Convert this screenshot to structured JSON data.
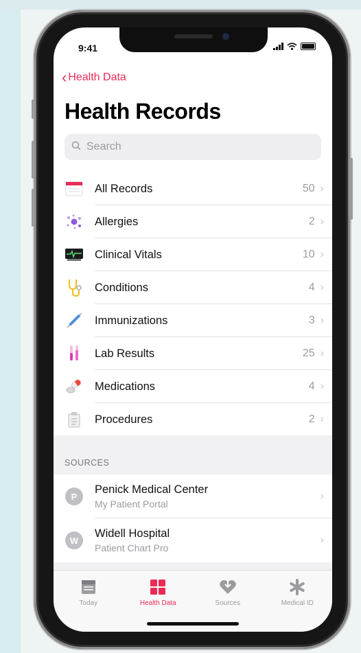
{
  "status": {
    "time": "9:41"
  },
  "nav": {
    "back_label": "Health Data"
  },
  "page": {
    "title": "Health Records"
  },
  "search": {
    "placeholder": "Search"
  },
  "records": [
    {
      "label": "All Records",
      "count": "50",
      "icon": "all-records-icon"
    },
    {
      "label": "Allergies",
      "count": "2",
      "icon": "allergies-icon"
    },
    {
      "label": "Clinical Vitals",
      "count": "10",
      "icon": "clinical-vitals-icon"
    },
    {
      "label": "Conditions",
      "count": "4",
      "icon": "stethoscope-icon"
    },
    {
      "label": "Immunizations",
      "count": "3",
      "icon": "syringe-icon"
    },
    {
      "label": "Lab Results",
      "count": "25",
      "icon": "test-tubes-icon"
    },
    {
      "label": "Medications",
      "count": "4",
      "icon": "pills-icon"
    },
    {
      "label": "Procedures",
      "count": "2",
      "icon": "procedures-icon"
    }
  ],
  "sources": {
    "header": "SOURCES",
    "items": [
      {
        "initial": "P",
        "name": "Penick Medical Center",
        "subtitle": "My Patient Portal"
      },
      {
        "initial": "W",
        "name": "Widell Hospital",
        "subtitle": "Patient Chart Pro"
      }
    ]
  },
  "tabs": [
    {
      "label": "Today",
      "icon": "today-icon",
      "active": false
    },
    {
      "label": "Health Data",
      "icon": "grid-icon",
      "active": true
    },
    {
      "label": "Sources",
      "icon": "heart-icon",
      "active": false
    },
    {
      "label": "Medical ID",
      "icon": "asterisk-icon",
      "active": false
    }
  ],
  "colors": {
    "accent": "#ea2c55",
    "secondary_text": "#9b9ba0"
  }
}
